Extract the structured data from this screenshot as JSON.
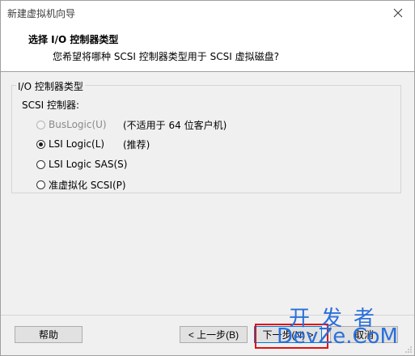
{
  "window": {
    "title": "新建虚拟机向导"
  },
  "header": {
    "title": "选择 I/O 控制器类型",
    "subtitle": "您希望将哪种 SCSI 控制器类型用于 SCSI 虚拟磁盘?"
  },
  "group": {
    "legend": "I/O 控制器类型",
    "section_label": "SCSI 控制器:",
    "options": [
      {
        "label": "BusLogic(U)",
        "note": "(不适用于 64 位客户机)",
        "checked": false,
        "disabled": true
      },
      {
        "label": "LSI Logic(L)",
        "note": "(推荐)",
        "checked": true,
        "disabled": false
      },
      {
        "label": "LSI Logic SAS(S)",
        "note": "",
        "checked": false,
        "disabled": false
      },
      {
        "label": "准虚拟化 SCSI(P)",
        "note": "",
        "checked": false,
        "disabled": false
      }
    ]
  },
  "footer": {
    "help_label": "帮助",
    "back_label": "< 上一步(B)",
    "next_label": "下一步(N) >",
    "cancel_label": "取消"
  },
  "watermark": {
    "line1": "开发者",
    "line2": "DevZe.CoM",
    "color": "#2a6fdb"
  },
  "colors": {
    "highlight": "#e01010",
    "focus": "#0078d7"
  }
}
